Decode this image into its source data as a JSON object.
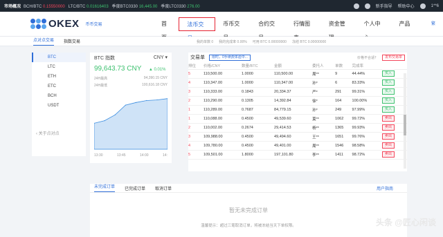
{
  "topbar": {
    "market": "市场概况",
    "tickers": [
      {
        "pair": "BCH/BTC",
        "price": "0.15550000",
        "dir": "dn"
      },
      {
        "pair": "LTC/BTC",
        "price": "0.01616403",
        "dir": "up"
      },
      {
        "pair": "季度BTC0330",
        "price": "16,445.00",
        "dir": "up"
      },
      {
        "pair": "季度LTC0330",
        "price": "276.00",
        "dir": "up"
      }
    ],
    "guide": "新手指导",
    "help": "帮助中心",
    "user": "1**6"
  },
  "header": {
    "logo": "OKEX",
    "logo_sub": "币币交易",
    "nav": [
      "首页",
      "法币交易",
      "币币交易",
      "合约交易",
      "行情图表",
      "资金管理",
      "个人中心",
      "产品"
    ],
    "active_index": 1,
    "lang": "繁"
  },
  "subbar": {
    "tabs": [
      "点对点交易",
      "指数交易"
    ],
    "active": 0
  },
  "coins": {
    "items": [
      "BTC",
      "LTC",
      "ETH",
      "ETC",
      "BCH",
      "USDT"
    ],
    "active": 0,
    "focus": "关于点对点"
  },
  "index": {
    "title": "BTC 指数",
    "currency": "CNY",
    "price": "99,643.73 CNY",
    "change": "0.01%",
    "high_label": "24H最高",
    "high": "94,390.15 CNY",
    "low_label": "24H最低",
    "low": "100,616.18 CNY",
    "x_ticks": [
      "13:30",
      "13:45",
      "14:00",
      "14:"
    ]
  },
  "chart_data": {
    "type": "area",
    "title": "",
    "x": [
      "13:30",
      "13:35",
      "13:40",
      "13:45",
      "13:50",
      "13:55",
      "14:00",
      "14:05"
    ],
    "values": [
      40,
      44,
      53,
      68,
      72,
      75,
      76,
      78
    ],
    "ylim": [
      0,
      100
    ],
    "color": "#3b8de0"
  },
  "trade": {
    "title": "交易单",
    "badge": "限时，0手续费体验中...",
    "hint": "价格不合适？",
    "publish": "发布交易单",
    "stats": [
      "我的单数 0",
      "我的完成率 0.00%",
      "可用 BTC 0.00000000",
      "冻结 BTC 0.00000000"
    ],
    "columns": [
      "排位",
      "价格/CNY",
      "数量/BTC",
      "金额",
      "委托人",
      "单数",
      "完成率",
      ""
    ],
    "rows": [
      {
        "rank": "5",
        "price": "110,500.00",
        "qty": "1.0000",
        "amount": "110,500.00",
        "user": "周**",
        "count": "9",
        "rate": "44.44%",
        "action": "买入",
        "side": "buy"
      },
      {
        "rank": "4",
        "price": "110,347.00",
        "qty": "1.0000",
        "amount": "110,347.00",
        "user": "孙*",
        "count": "6",
        "rate": "83.33%",
        "action": "买入",
        "side": "buy"
      },
      {
        "rank": "3",
        "price": "110,333.00",
        "qty": "0.1843",
        "amount": "20,334.37",
        "user": "严*",
        "count": "291",
        "rate": "99.31%",
        "action": "买入",
        "side": "buy"
      },
      {
        "rank": "2",
        "price": "110,290.00",
        "qty": "0.1305",
        "amount": "14,392.84",
        "user": "徐*",
        "count": "164",
        "rate": "100.00%",
        "action": "买入",
        "side": "buy"
      },
      {
        "rank": "1",
        "price": "110,289.00",
        "qty": "0.7687",
        "amount": "84,779.15",
        "user": "孙*",
        "count": "249",
        "rate": "97.99%",
        "action": "买入",
        "side": "buy"
      },
      {
        "rank": "1",
        "price": "110,088.00",
        "qty": "0.4500",
        "amount": "49,539.60",
        "user": "莫**",
        "count": "1062",
        "rate": "99.72%",
        "action": "卖出",
        "side": "sell"
      },
      {
        "rank": "2",
        "price": "110,002.00",
        "qty": "0.2674",
        "amount": "29,414.53",
        "user": "杨**",
        "count": "1365",
        "rate": "99.93%",
        "action": "卖出",
        "side": "sell"
      },
      {
        "rank": "3",
        "price": "109,988.00",
        "qty": "0.4500",
        "amount": "49,494.60",
        "user": "王**",
        "count": "1651",
        "rate": "99.76%",
        "action": "卖出",
        "side": "sell"
      },
      {
        "rank": "4",
        "price": "109,780.00",
        "qty": "0.4500",
        "amount": "49,401.00",
        "user": "周**",
        "count": "1546",
        "rate": "98.58%",
        "action": "卖出",
        "side": "sell"
      },
      {
        "rank": "5",
        "price": "109,501.00",
        "qty": "1.8000",
        "amount": "197,101.80",
        "user": "李**",
        "count": "1411",
        "rate": "98.72%",
        "action": "卖出",
        "side": "sell"
      }
    ]
  },
  "orders": {
    "tabs": [
      "未完成订单",
      "已完成订单",
      "取消订单"
    ],
    "active": 0,
    "guide": "用户指南",
    "empty": "暂无未完成订单",
    "tip": "温馨提示：超过三笔取消订单，将被冻结当天下单权限。"
  },
  "watermark": "头条 @匠心闲谈"
}
